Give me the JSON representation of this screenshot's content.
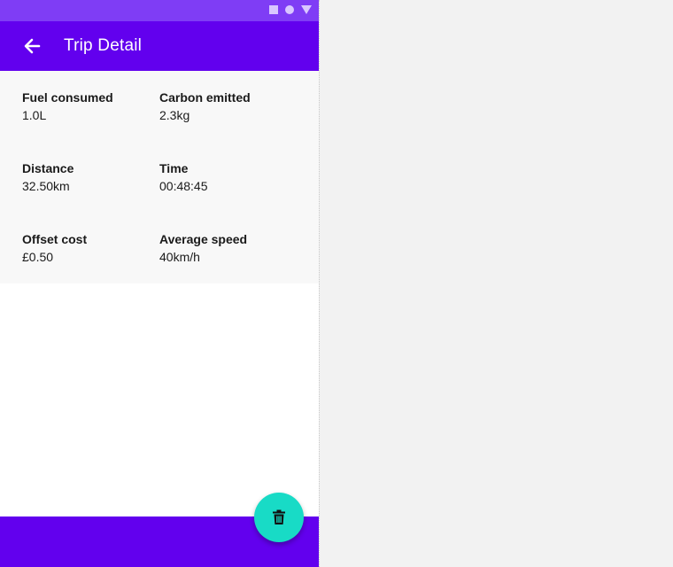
{
  "app_bar": {
    "title": "Trip Detail",
    "back_icon": "arrow-left-icon",
    "color": "#6200ee"
  },
  "status_bar": {
    "color": "#7f3df5",
    "icons": [
      "square-icon",
      "circle-icon",
      "triangle-icon"
    ]
  },
  "stats": [
    {
      "label": "Fuel consumed",
      "value": "1.0L"
    },
    {
      "label": "Carbon emitted",
      "value": "2.3kg"
    },
    {
      "label": "Distance",
      "value": "32.50km"
    },
    {
      "label": "Time",
      "value": "00:48:45"
    },
    {
      "label": "Offset cost",
      "value": "£0.50"
    },
    {
      "label": "Average speed",
      "value": "40km/h"
    }
  ],
  "fab": {
    "icon": "trash-icon",
    "color": "#18dbc6"
  }
}
